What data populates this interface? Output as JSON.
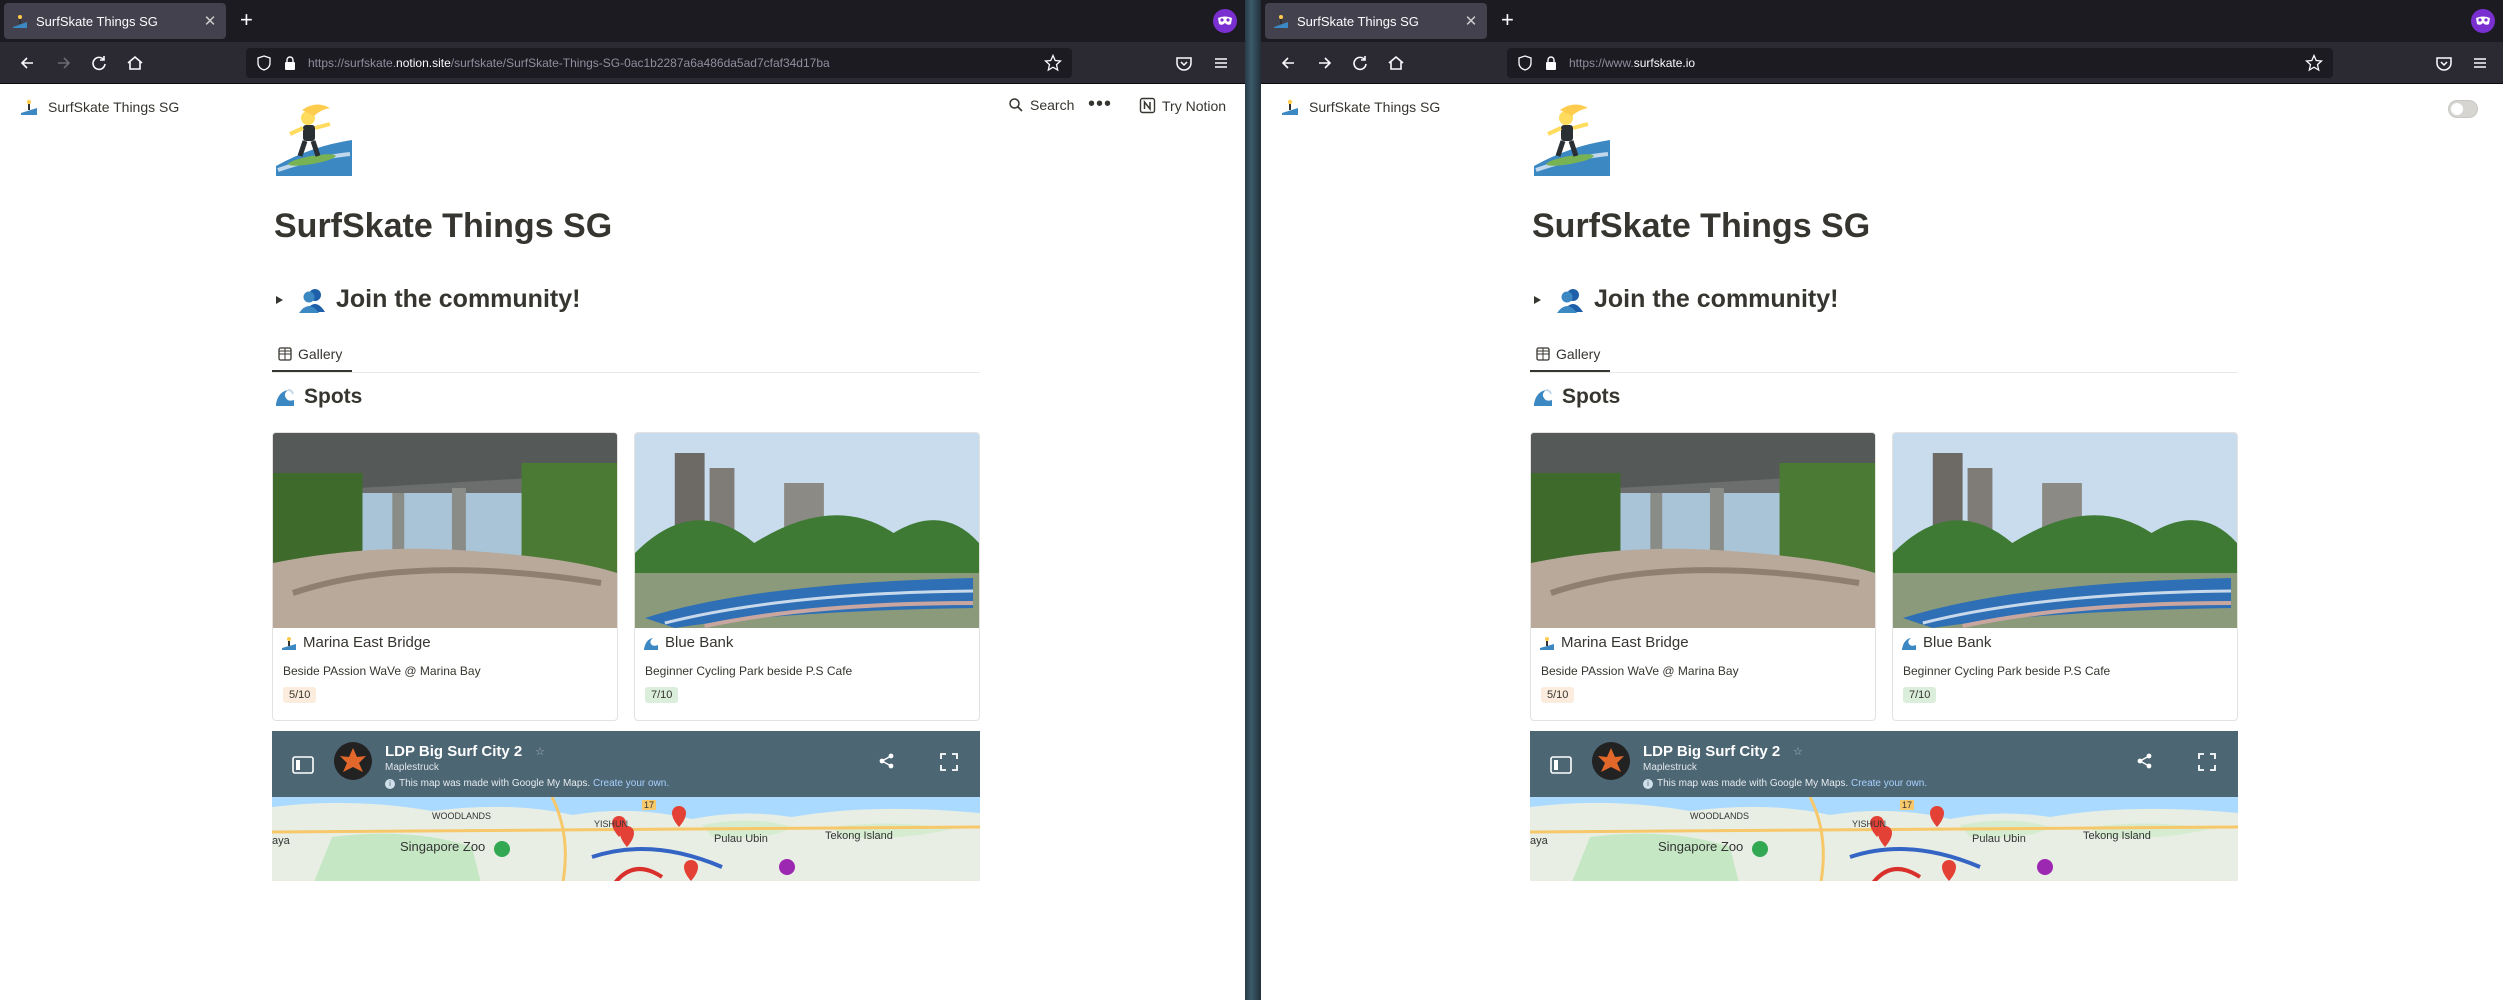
{
  "windows": [
    {
      "tab_title": "SurfSkate Things SG",
      "url_prefix": "https://surfskate.",
      "url_domain": "notion.site",
      "url_path": "/surfskate/SurfSkate-Things-SG-0ac1b2287a6a486da5ad7cfaf34d17ba",
      "site_title": "SurfSkate Things SG",
      "search_label": "Search",
      "try_label": "Try Notion"
    },
    {
      "tab_title": "SurfSkate Things SG",
      "url_prefix": "https://www.",
      "url_domain": "surfskate.io",
      "url_path": "",
      "site_title": "SurfSkate Things SG"
    }
  ],
  "page": {
    "title": "SurfSkate Things SG",
    "community_heading": "Join the community!",
    "view_tab": "Gallery",
    "collection_title": "Spots",
    "cards": [
      {
        "name": "Marina East Bridge",
        "desc": "Beside PAssion WaVe @ Marina Bay",
        "rating": "5/10",
        "rating_color": "#fbecdd"
      },
      {
        "name": "Blue Bank",
        "desc": "Beginner Cycling Park beside P.S Cafe",
        "rating": "7/10",
        "rating_color": "#dbeddb"
      }
    ],
    "map": {
      "title": "LDP Big Surf City 2",
      "author": "Maplestruck",
      "info_text": "This map was made with Google My Maps.",
      "info_link": "Create your own.",
      "labels": [
        "WOODLANDS",
        "YISHUN",
        "Singapore Zoo",
        "Pulau Ubin",
        "Tekong Island",
        "aya",
        "17"
      ]
    }
  },
  "icons": {
    "back": "back-arrow-icon",
    "forward": "forward-arrow-icon",
    "reload": "reload-icon",
    "home": "home-icon",
    "shield": "shield-icon",
    "lock": "lock-icon",
    "bookmark": "star-icon",
    "pocket": "pocket-icon",
    "menu": "hamburger-menu-icon",
    "extension": "mask-extension-icon"
  },
  "colors": {
    "accent": "#7a2fd0",
    "map_bar": "#4d6674",
    "text": "#37352f"
  }
}
